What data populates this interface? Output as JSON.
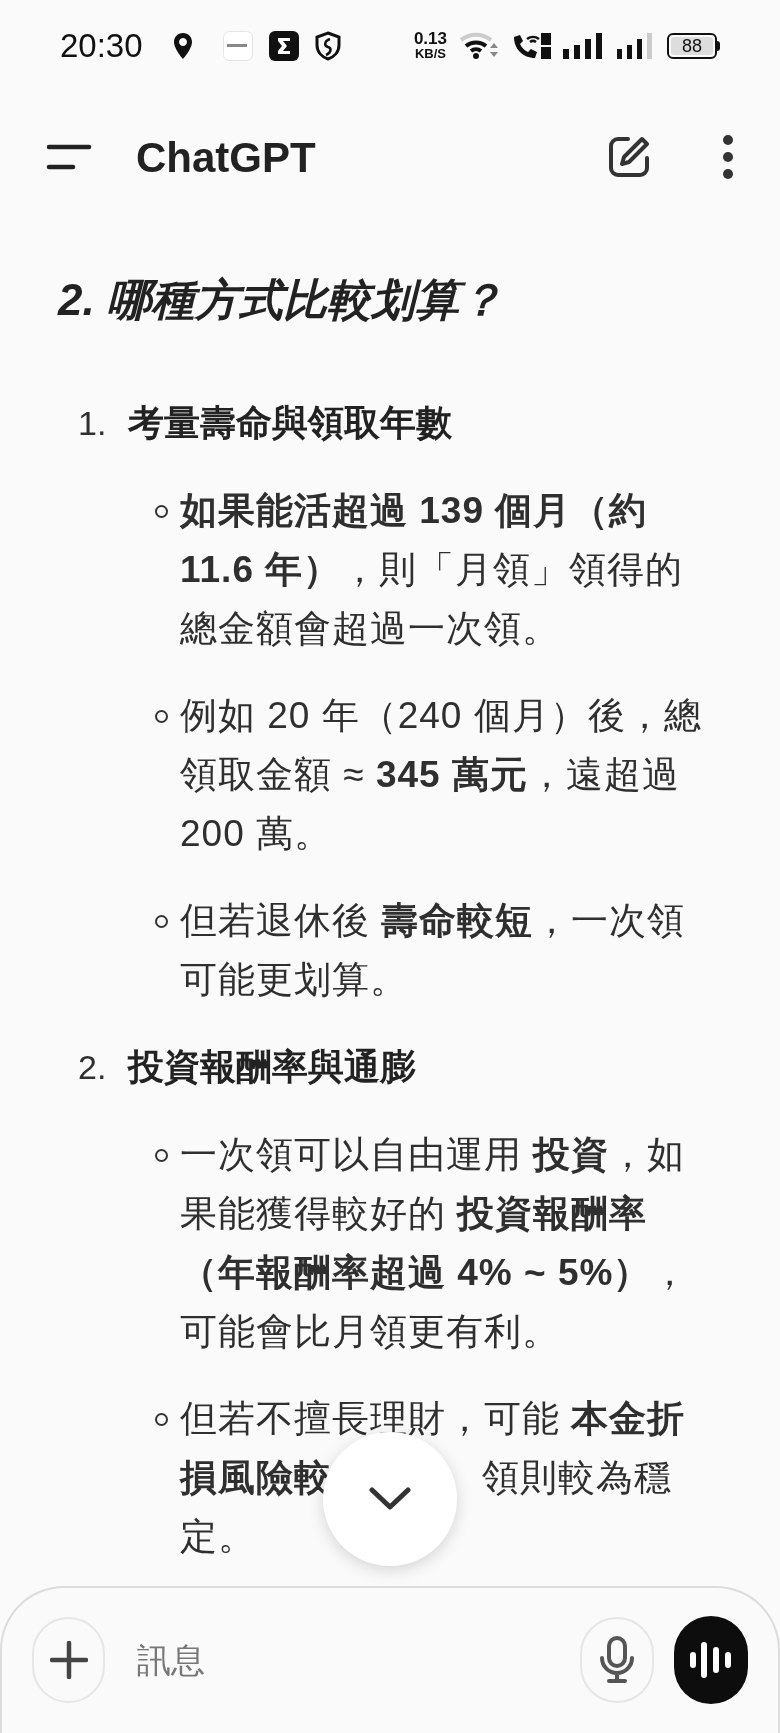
{
  "status_bar": {
    "time": "20:30",
    "net_speed": "0.13",
    "net_unit": "KB/S",
    "battery": "88"
  },
  "header": {
    "title": "ChatGPT"
  },
  "message": {
    "heading": "2. 哪種方式比較划算？",
    "sections": [
      {
        "number": "1.",
        "title": "考量壽命與領取年數",
        "bullets": [
          {
            "text": "**如果能活超過 139 個月（約 11.6 年）**，則「月領」領得的總金額會超過一次領。"
          },
          {
            "text": "例如 20 年（240 個月）後，總領取金額 ≈ **345 萬元**，遠超過 200 萬。"
          },
          {
            "text": "但若退休後 **壽命較短**，一次領可能更划算。"
          }
        ]
      },
      {
        "number": "2.",
        "title": "投資報酬率與通膨",
        "bullets": [
          {
            "text": "一次領可以自由運用 **投資**，如果能獲得較好的 **投資報酬率（年報酬率超過 4% ~ 5%）**，可能會比月領更有利。"
          },
          {
            "lines": [
              [
                "但若不擅長理財，可能 **本金折**"
              ],
              [
                "**損風險較**",
                "領則較為穩"
              ],
              [
                "定。"
              ]
            ]
          }
        ]
      }
    ]
  },
  "composer": {
    "placeholder": "訊息"
  }
}
